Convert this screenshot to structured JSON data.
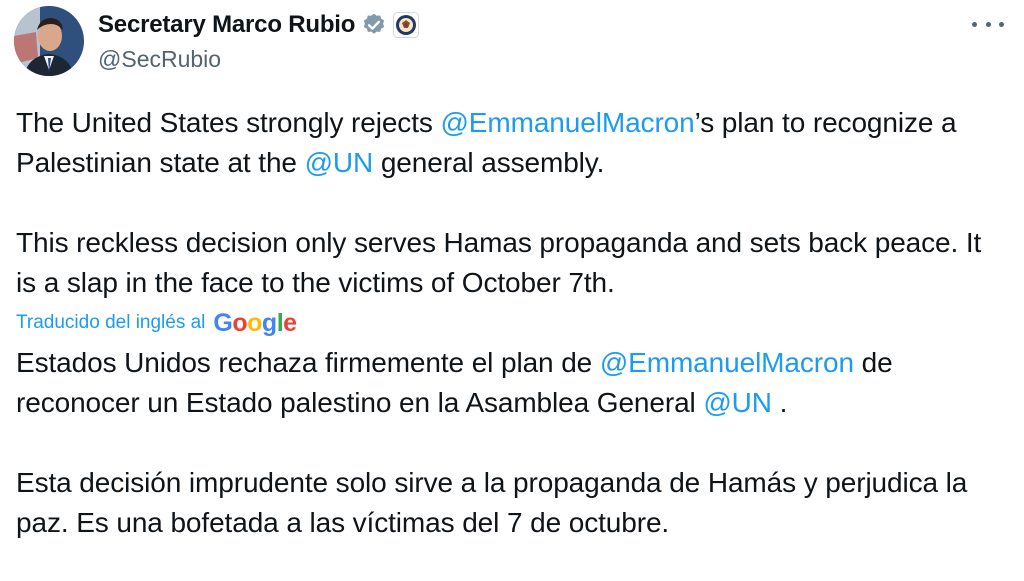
{
  "author": {
    "display_name": "Secretary Marco Rubio",
    "handle": "@SecRubio",
    "verified_icon": "verified-badge-icon",
    "affiliation_icon": "state-department-seal-icon"
  },
  "menu": {
    "icon": "more-options-icon"
  },
  "tweet": {
    "en_p1": {
      "part1": "The United States strongly rejects ",
      "mention1": "@EmmanuelMacron",
      "part2": "’s plan to recognize a Palestinian state at the ",
      "mention2": "@UN",
      "part3": " general assembly."
    },
    "en_p2": "This reckless decision only serves Hamas propaganda and sets back peace. It is a slap in the face to the victims of October 7th.",
    "translated_label": "Traducido del inglés al",
    "translator_brand": [
      "G",
      "o",
      "o",
      "g",
      "l",
      "e"
    ],
    "es_p1": {
      "part1": "Estados Unidos rechaza firmemente el plan de ",
      "mention1": "@EmmanuelMacron",
      "part2": " de reconocer un Estado palestino en la Asamblea General ",
      "mention2": "@UN",
      "part3": " ."
    },
    "es_p2": "Esta decisión imprudente solo sirve a la propaganda de Hamás y perjudica la paz. Es una bofetada a las víctimas del 7 de octubre."
  },
  "colors": {
    "link": "#1d9bf0",
    "text": "#0f1419",
    "secondary": "#536471",
    "verified_badge": "#829aab"
  }
}
